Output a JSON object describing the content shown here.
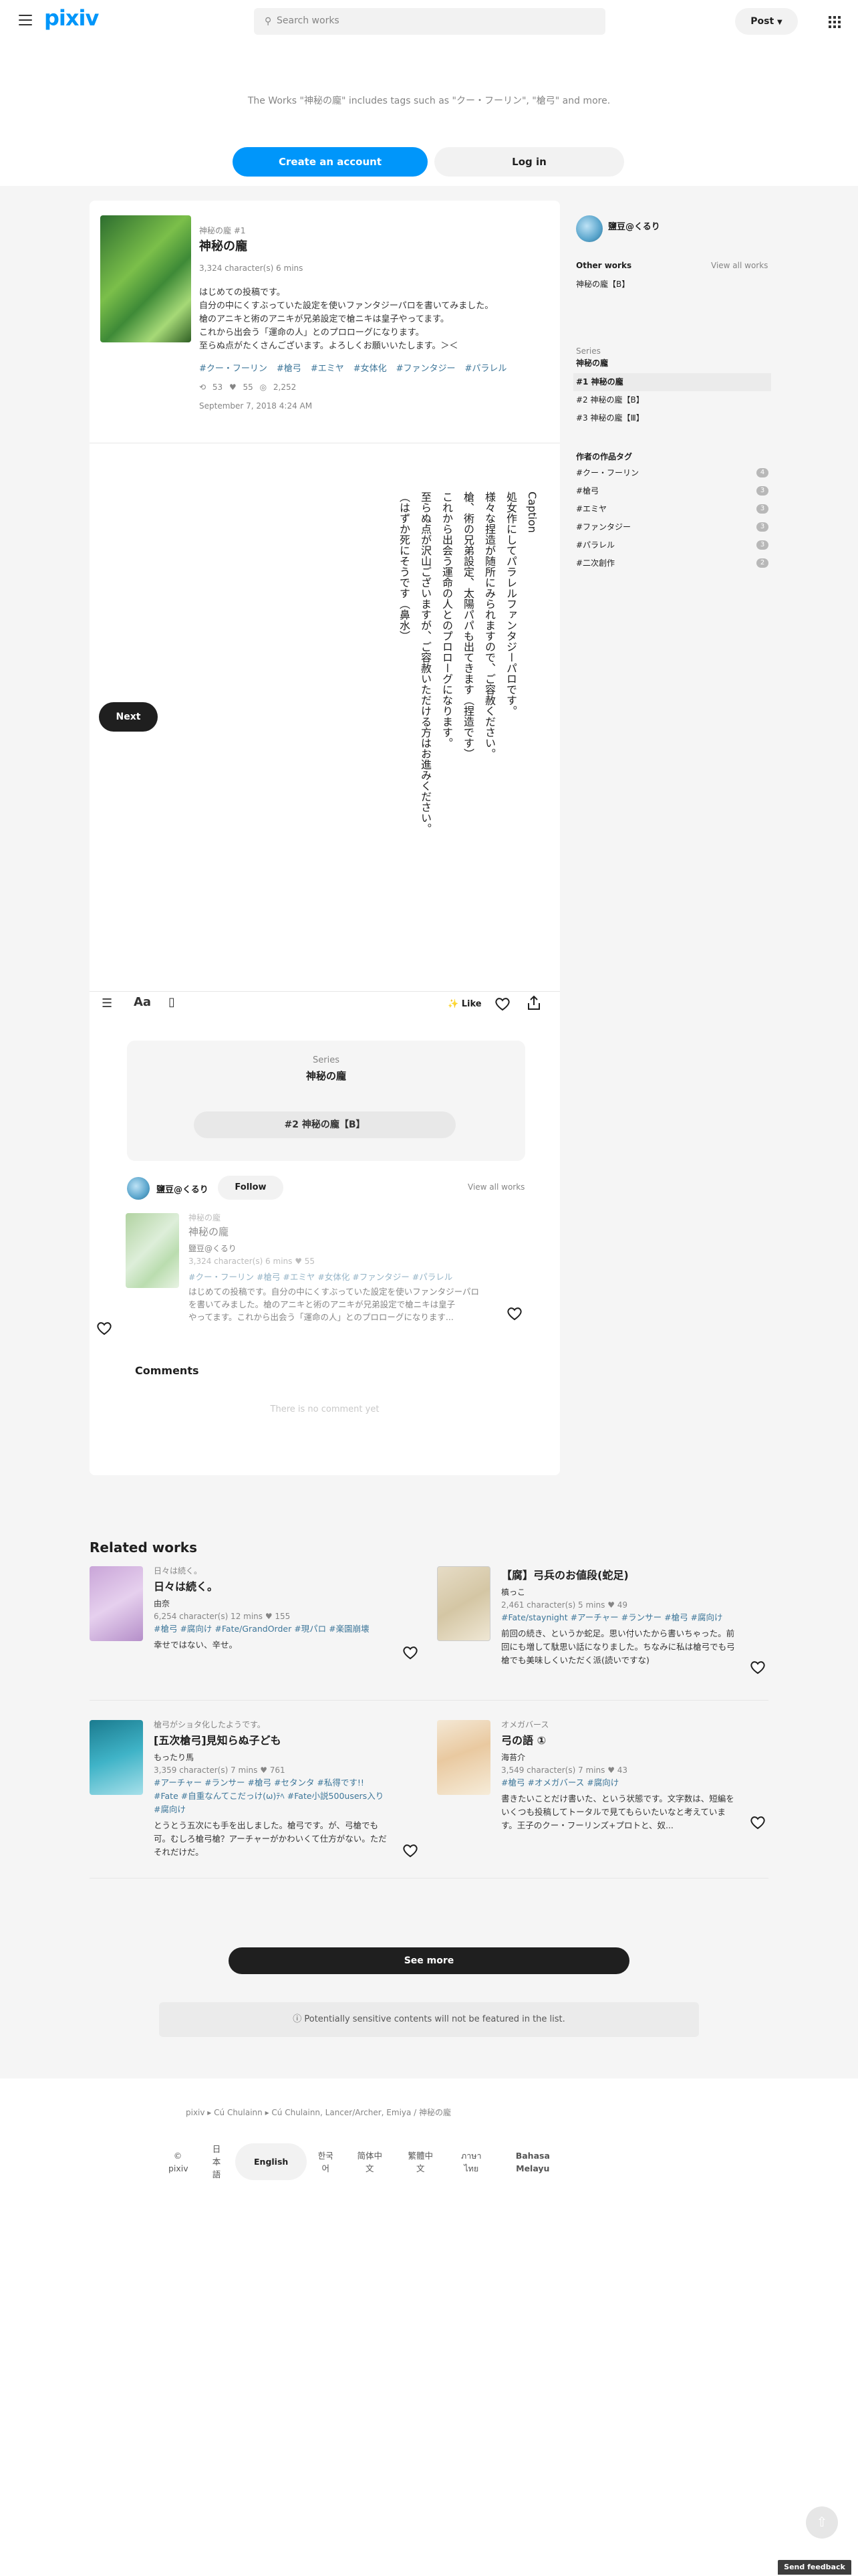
{
  "header": {
    "logo": "pixiv",
    "search_placeholder": "Search works",
    "post_label": "Post"
  },
  "promo": {
    "text": "The Works \"神秘の龐\" includes tags such as \"クー・フーリン\", \"槍弓\" and more.",
    "create_account": "Create an account",
    "login": "Log in"
  },
  "work": {
    "series_label": "神秘の龐 #1",
    "title": "神秘の龐",
    "meta": "3,324 character(s)   6 mins",
    "description": [
      "はじめての投稿です。",
      "自分の中にくすぶっていた設定を使いファンタジーパロを書いてみました。",
      "槍のアニキと術のアニキが兄弟設定で槍ニキは皇子やってます。",
      "これから出会う「運命の人」とのプロローグになります。",
      "至らぬ点がたくさんございます。よろしくお願いいたします。＞＜"
    ],
    "tags": [
      "#クー・フーリン",
      "#槍弓",
      "#エミヤ",
      "#女体化",
      "#ファンタジー",
      "#パラレル"
    ],
    "stats": {
      "views_icon": "⟲ 53",
      "likes": "♥ 55",
      "views": "◎ 2,252"
    },
    "date": "September 7, 2018 4:24 AM"
  },
  "caption": {
    "columns": [
      "Caption",
      "処女作にしてパラレルファンタジーパロです。",
      "様々な捏造が随所にみられますので、ご容赦ください。",
      "槍、術の兄弟設定、太陽パパも出てきます（捏造です）",
      "これから出会う運命の人とのプロローグになります。",
      "至らぬ点が沢山ございますが、ご容赦いただける方はお進みください。",
      "（はずか死にそうです（鼻水）"
    ]
  },
  "next_label": "Next",
  "toolbar": {
    "like_label": "Like"
  },
  "series_box": {
    "label": "Series",
    "name": "神秘の龐",
    "next_episode": "#2 神秘の龐【B】"
  },
  "author": {
    "name": "鹽豆@くるり",
    "follow": "Follow",
    "view_all": "View all works",
    "work_series": "神秘の龐",
    "work_title": "神秘の龐",
    "work_author": "鹽豆@くるり",
    "work_meta": "3,324 character(s)  6 mins  ♥ 55",
    "work_tags": "#クー・フーリン  #槍弓  #エミヤ  #女体化  #ファンタジー  #パラレル",
    "work_desc1": "はじめての投稿です。自分の中にくすぶっていた設定を使いファンタジーパロ",
    "work_desc2": "を書いてみました。槍のアニキと術のアニキが兄弟設定で槍ニキは皇子",
    "work_desc3": "やってます。これから出会う「運命の人」とのプロローグになります..."
  },
  "comments": {
    "title": "Comments",
    "empty": "There is no comment yet"
  },
  "sidebar": {
    "author_name": "鹽豆@くるり",
    "other_works": "Other works",
    "view_all": "View all works",
    "other_work_item": "神秘の龐【B】",
    "series_label": "Series",
    "series_name": "神秘の龐",
    "series_items": [
      "#1 神秘の龐",
      "#2 神秘の龐【B】",
      "#3 神秘の龐【Ⅲ】"
    ],
    "author_tags_title": "作者の作品タグ",
    "author_tags": [
      {
        "tag": "#クー・フーリン",
        "count": "4"
      },
      {
        "tag": "#槍弓",
        "count": "3"
      },
      {
        "tag": "#エミヤ",
        "count": "3"
      },
      {
        "tag": "#ファンタジー",
        "count": "3"
      },
      {
        "tag": "#パラレル",
        "count": "3"
      },
      {
        "tag": "#二次創作",
        "count": "2"
      }
    ]
  },
  "related": {
    "title": "Related works",
    "items": [
      {
        "series": "日々は続く。",
        "title": "日々は続く。",
        "author": "由奈",
        "meta": "6,254 character(s)  12 mins  ♥ 155",
        "tags": "#槍弓  #腐向け  #Fate/GrandOrder  #現パロ  #楽園崩壊",
        "desc": "幸せではない、辛せ。"
      },
      {
        "series": "",
        "title": "【腐】弓兵のお値段(蛇足)",
        "author": "槙っこ",
        "meta": "2,461 character(s)  5 mins  ♥ 49",
        "tags": "#Fate/staynight  #アーチャー  #ランサー  #槍弓  #腐向け",
        "desc": "前回の続き、というか蛇足。思い付いたから書いちゃった。前回にも増して駄思い話になりました。ちなみに私は槍弓でも弓槍でも美味しくいただく派(読いですな)"
      },
      {
        "series": "槍弓がショタ化したようです。",
        "title": "[五次槍弓]見知らぬ子ども",
        "author": "もったり馬",
        "meta": "3,359 character(s)  7 mins  ♥ 761",
        "tags": "#アーチャー  #ランサー  #槍弓  #セタンタ  #私得です!!  #Fate  #自重なんてこだっけ(ω)ﾃﾍ  #Fate小説500users入り  #腐向け",
        "desc": "とうとう五次にも手を出しました。槍弓です。が、弓槍でも可。むしろ槍弓槍？アーチャーがかわいくて仕方がない。ただそれだけだ。"
      },
      {
        "series": "オメガバース",
        "title": "弓の語 ①",
        "author": "海苔介",
        "meta": "3,549 character(s)  7 mins  ♥ 43",
        "tags": "#槍弓  #オメガバース  #腐向け",
        "desc": "書きたいことだけ書いた、という状態です。文字数は、短編をいくつも投稿してトータルで見てもらいたいなと考えています。王子のクー・フーリンズ+プロトと、奴..."
      }
    ]
  },
  "see_more": "See more",
  "warning": "Potentially sensitive contents will not be featured in the list.",
  "footer": {
    "breadcrumb": "pixiv ▸ Cú Chulainn ▸ Cú Chulainn, Lancer/Archer, Emiya / 神秘の龐",
    "languages": [
      "© pixiv",
      "日本語",
      "English",
      "한국어",
      "简体中文",
      "繁體中文",
      "ภาษาไทย",
      "Bahasa Melayu"
    ]
  },
  "feedback": "Send feedback",
  "colors": {
    "accent": "#0096fa",
    "tag": "#3d7699",
    "dark": "#1f1f1f"
  }
}
